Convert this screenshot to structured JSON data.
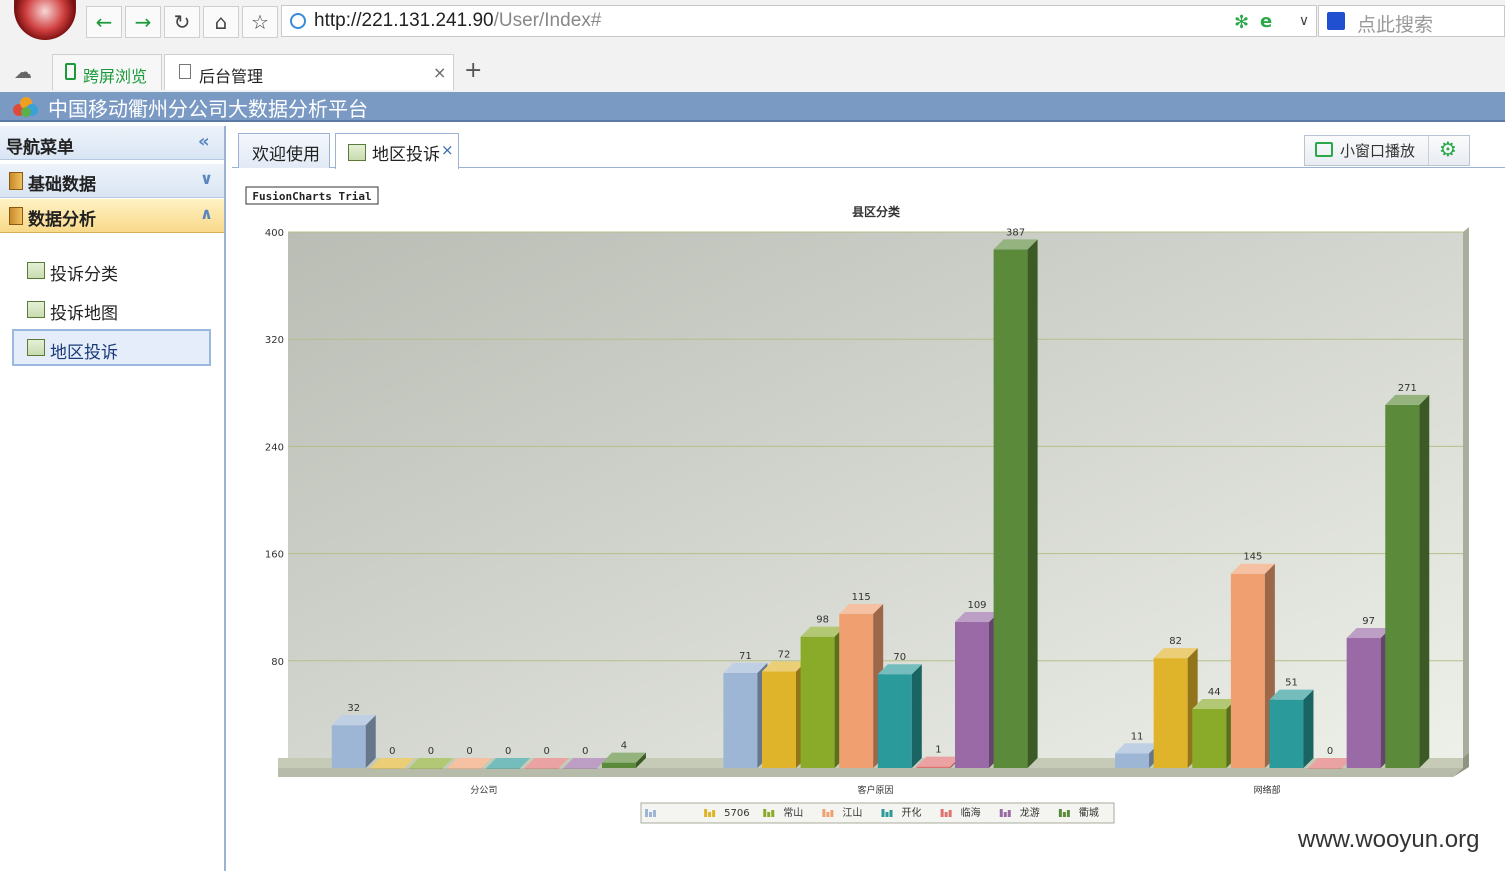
{
  "browser": {
    "url_host": "http://221.131.241.90",
    "url_path": "/User/Index#",
    "search_placeholder": "点此搜索",
    "tabs": [
      {
        "label": "跨屏浏览"
      },
      {
        "label": "后台管理"
      }
    ],
    "new_tab_symbol": "+"
  },
  "app": {
    "title": "中国移动衢州分公司大数据分析平台"
  },
  "sidebar": {
    "header": "导航菜单",
    "groups": [
      {
        "label": "基础数据"
      },
      {
        "label": "数据分析"
      }
    ],
    "items": [
      {
        "label": "投诉分类"
      },
      {
        "label": "投诉地图"
      },
      {
        "label": "地区投诉"
      }
    ]
  },
  "main": {
    "tabs": [
      {
        "label": "欢迎使用"
      },
      {
        "label": "地区投诉"
      }
    ],
    "toolbar": {
      "mini_window_label": "小窗口播放"
    }
  },
  "chart_data": {
    "type": "bar",
    "title": "县区分类",
    "trial_badge": "FusionCharts Trial",
    "categories": [
      "分公司",
      "客户原因",
      "网络部"
    ],
    "ylim": [
      0,
      400
    ],
    "yticks": [
      0,
      80,
      160,
      240,
      320,
      400
    ],
    "grid": true,
    "legend_position": "bottom",
    "series": [
      {
        "name": "",
        "color": "#9db6d6",
        "values": [
          32,
          71,
          11
        ]
      },
      {
        "name": "5706",
        "color": "#e0b42a",
        "values": [
          0,
          72,
          82
        ]
      },
      {
        "name": "常山",
        "color": "#8aab2a",
        "values": [
          0,
          98,
          44
        ]
      },
      {
        "name": "江山",
        "color": "#f0a070",
        "values": [
          0,
          115,
          145
        ]
      },
      {
        "name": "开化",
        "color": "#2a9a9a",
        "values": [
          0,
          70,
          51
        ]
      },
      {
        "name": "临海",
        "color": "#e07070",
        "values": [
          0,
          1,
          0
        ]
      },
      {
        "name": "龙游",
        "color": "#9a6aa6",
        "values": [
          0,
          109,
          97
        ]
      },
      {
        "name": "衢城",
        "color": "#5a8a3a",
        "values": [
          4,
          387,
          271
        ]
      }
    ]
  },
  "watermark": "www.wooyun.org"
}
